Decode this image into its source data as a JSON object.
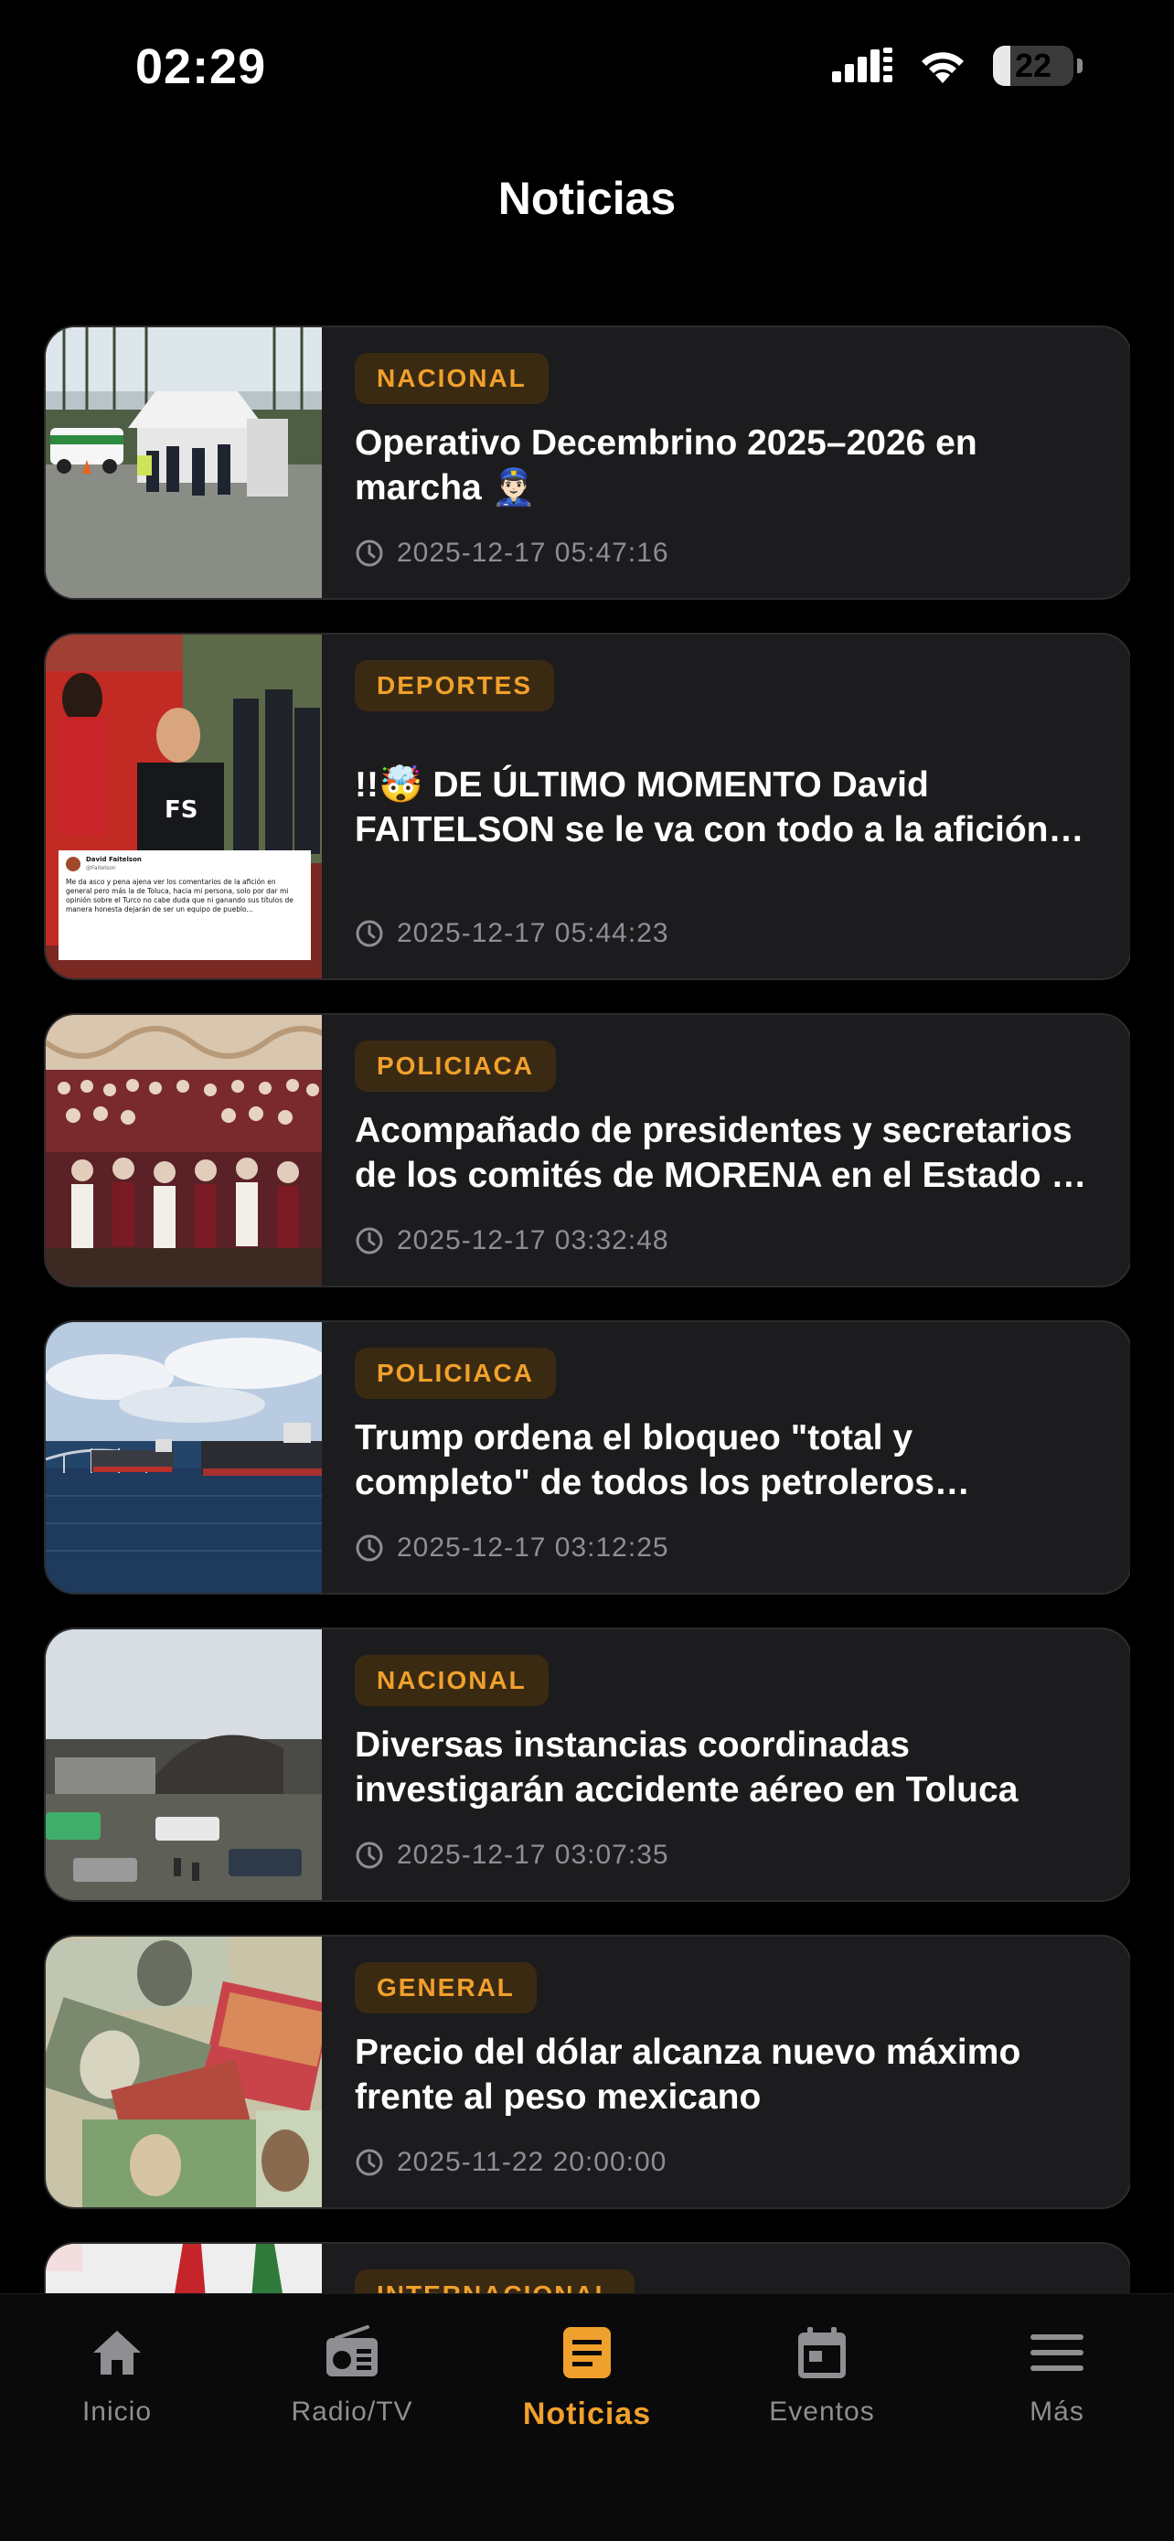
{
  "status_bar": {
    "time": "02:29",
    "battery_level": "22",
    "battery_fraction": 0.22
  },
  "header": {
    "title": "Noticias"
  },
  "news": [
    {
      "category": "NACIONAL",
      "title": "Operativo Decembrino 2025–2026 en marcha 👮🏻‍♂️",
      "datetime": "2025-12-17 05:47:16",
      "thumbnail": "checkpoint-tent-photo"
    },
    {
      "category": "DEPORTES",
      "title": "!!🤯 DE ÚLTIMO MOMENTO David FAITELSON se le va con todo a la afición del Toluca",
      "datetime": "2025-12-17 05:44:23",
      "thumbnail": "stadium-tweet-photo",
      "tweet": {
        "author": "David Faitelson",
        "handle": "@Faitelson",
        "text": "Me da asco y pena ajena ver los comentarios de la afición en general pero más la de Toluca, hacia mi persona, solo por dar mi opinión sobre el Turco no cabe duda que ni ganando sus títulos de manera honesta dejarán de ser un equipo de pueblo..."
      }
    },
    {
      "category": "POLICIACA",
      "title": "Acompañado de presidentes y secretarios de los comités de MORENA en el Estado de México",
      "datetime": "2025-12-17 03:32:48",
      "thumbnail": "crowd-event-photo"
    },
    {
      "category": "POLICIACA",
      "title": "Trump ordena el bloqueo \"total y completo\" de todos los petroleros sancionados",
      "datetime": "2025-12-17 03:12:25",
      "thumbnail": "oil-tankers-photo"
    },
    {
      "category": "NACIONAL",
      "title": "Diversas instancias coordinadas investigarán accidente aéreo en Toluca",
      "datetime": "2025-12-17 03:07:35",
      "thumbnail": "crash-site-photo"
    },
    {
      "category": "GENERAL",
      "title": "Precio del dólar alcanza nuevo máximo frente al peso mexicano",
      "datetime": "2025-11-22 20:00:00",
      "thumbnail": "banknotes-photo"
    },
    {
      "category": "INTERNACIONAL",
      "title": "",
      "datetime": "",
      "thumbnail": "flags-photo"
    }
  ],
  "tab_bar": {
    "items": [
      {
        "label": "Inicio",
        "icon": "home-icon",
        "active": false
      },
      {
        "label": "Radio/TV",
        "icon": "radio-icon",
        "active": false
      },
      {
        "label": "Noticias",
        "icon": "news-icon",
        "active": true
      },
      {
        "label": "Eventos",
        "icon": "calendar-icon",
        "active": false
      },
      {
        "label": "Más",
        "icon": "menu-icon",
        "active": false
      }
    ]
  },
  "colors": {
    "background": "#000000",
    "card": "#1c1c1e",
    "accent": "#f0a02c",
    "badge_bg": "#3b2a12",
    "muted": "#8e8e93"
  }
}
